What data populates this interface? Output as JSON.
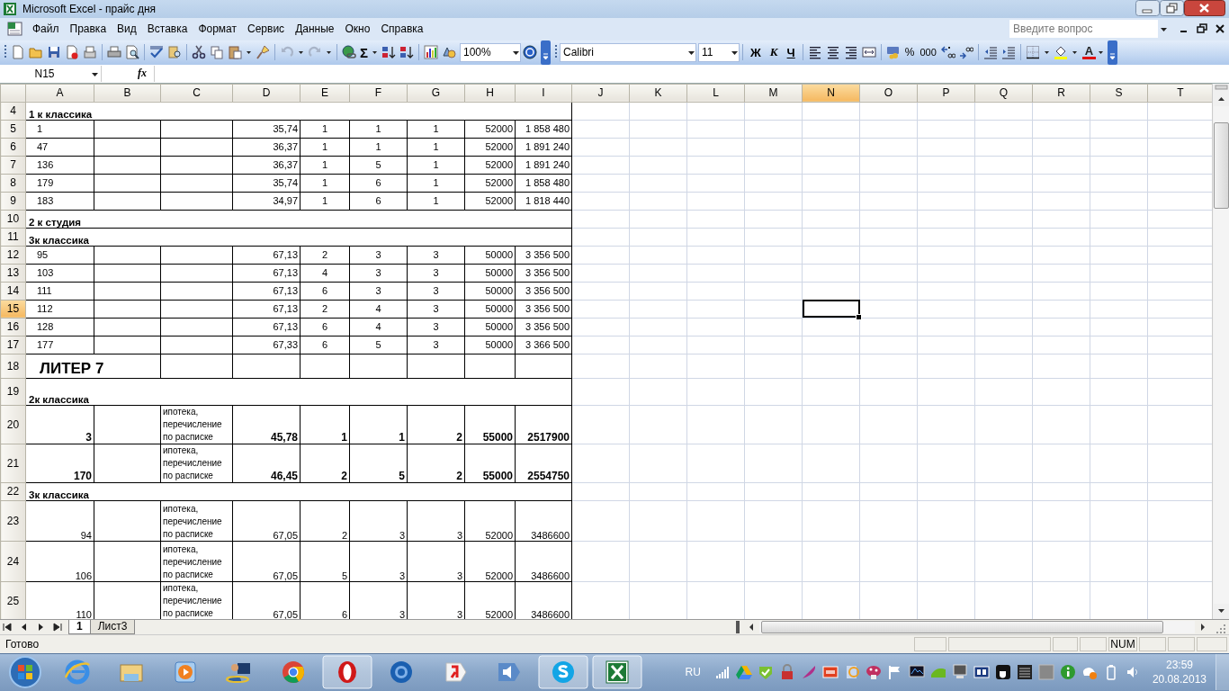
{
  "window": {
    "title": "Microsoft Excel - прайс дня"
  },
  "menu": [
    "Файл",
    "Правка",
    "Вид",
    "Вставка",
    "Формат",
    "Сервис",
    "Данные",
    "Окно",
    "Справка"
  ],
  "help_search": {
    "placeholder": "Введите вопрос"
  },
  "toolbar": {
    "undo": {
      "disabled": true
    },
    "redo": {
      "disabled": true
    },
    "sum": "Σ",
    "zoom": "100%",
    "font": "Calibri",
    "font_size": "11",
    "bold": "Ж",
    "italic": "К",
    "underline": "Ч",
    "percent": "%",
    "thousands": "000",
    "font_color": "A"
  },
  "formula_bar": {
    "name_box": "N15",
    "fx": "fx"
  },
  "sheet": {
    "columns": [
      {
        "letter": "A",
        "selected": false
      },
      {
        "letter": "B",
        "selected": false
      },
      {
        "letter": "C",
        "selected": false
      },
      {
        "letter": "D",
        "selected": false
      },
      {
        "letter": "E",
        "selected": false
      },
      {
        "letter": "F",
        "selected": false
      },
      {
        "letter": "G",
        "selected": false
      },
      {
        "letter": "H",
        "selected": false
      },
      {
        "letter": "I",
        "selected": false
      },
      {
        "letter": "J",
        "selected": false
      },
      {
        "letter": "K",
        "selected": false
      },
      {
        "letter": "L",
        "selected": false
      },
      {
        "letter": "M",
        "selected": false
      },
      {
        "letter": "N",
        "selected": true
      },
      {
        "letter": "O",
        "selected": false
      },
      {
        "letter": "P",
        "selected": false
      },
      {
        "letter": "Q",
        "selected": false
      },
      {
        "letter": "R",
        "selected": false
      },
      {
        "letter": "S",
        "selected": false
      },
      {
        "letter": "T",
        "selected": false
      }
    ],
    "rows": [
      {
        "number": "4",
        "selected": false,
        "kind": "section",
        "label": "1 к классика"
      },
      {
        "number": "5",
        "selected": false,
        "kind": "unit",
        "cells": {
          "A": "1",
          "D": "35,74",
          "E": "1",
          "F": "1",
          "G": "1",
          "H": "52000",
          "I": "1 858 480"
        }
      },
      {
        "number": "6",
        "selected": false,
        "kind": "unit",
        "cells": {
          "A": "47",
          "D": "36,37",
          "E": "1",
          "F": "1",
          "G": "1",
          "H": "52000",
          "I": "1 891 240"
        }
      },
      {
        "number": "7",
        "selected": false,
        "kind": "unit",
        "cells": {
          "A": "136",
          "D": "36,37",
          "E": "1",
          "F": "5",
          "G": "1",
          "H": "52000",
          "I": "1 891 240"
        }
      },
      {
        "number": "8",
        "selected": false,
        "kind": "unit",
        "cells": {
          "A": "179",
          "D": "35,74",
          "E": "1",
          "F": "6",
          "G": "1",
          "H": "52000",
          "I": "1 858 480"
        }
      },
      {
        "number": "9",
        "selected": false,
        "kind": "unit",
        "cells": {
          "A": "183",
          "D": "34,97",
          "E": "1",
          "F": "6",
          "G": "1",
          "H": "52000",
          "I": "1 818 440"
        }
      },
      {
        "number": "10",
        "selected": false,
        "kind": "section",
        "label": "2 к студия"
      },
      {
        "number": "11",
        "selected": false,
        "kind": "section",
        "label": "3к классика"
      },
      {
        "number": "12",
        "selected": false,
        "kind": "unit",
        "cells": {
          "A": "95",
          "D": "67,13",
          "E": "2",
          "F": "3",
          "G": "3",
          "H": "50000",
          "I": "3 356 500"
        }
      },
      {
        "number": "13",
        "selected": false,
        "kind": "unit",
        "cells": {
          "A": "103",
          "D": "67,13",
          "E": "4",
          "F": "3",
          "G": "3",
          "H": "50000",
          "I": "3 356 500"
        }
      },
      {
        "number": "14",
        "selected": false,
        "kind": "unit",
        "cells": {
          "A": "111",
          "D": "67,13",
          "E": "6",
          "F": "3",
          "G": "3",
          "H": "50000",
          "I": "3 356 500"
        }
      },
      {
        "number": "15",
        "selected": true,
        "kind": "unit",
        "cells": {
          "A": "112",
          "D": "67,13",
          "E": "2",
          "F": "4",
          "G": "3",
          "H": "50000",
          "I": "3 356 500"
        }
      },
      {
        "number": "16",
        "selected": false,
        "kind": "unit",
        "cells": {
          "A": "128",
          "D": "67,13",
          "E": "6",
          "F": "4",
          "G": "3",
          "H": "50000",
          "I": "3 356 500"
        }
      },
      {
        "number": "17",
        "selected": false,
        "kind": "unit",
        "cells": {
          "A": "177",
          "D": "67,33",
          "E": "6",
          "F": "5",
          "G": "3",
          "H": "50000",
          "I": "3 366 500"
        }
      },
      {
        "number": "18",
        "selected": false,
        "kind": "title",
        "label": "ЛИТЕР 7"
      },
      {
        "number": "19",
        "selected": false,
        "kind": "section",
        "label": "2к классика"
      },
      {
        "number": "20",
        "selected": false,
        "kind": "detail",
        "bold": true,
        "cells": {
          "A": "3",
          "C": "ипотека, перечисление по расписке",
          "D": "45,78",
          "E": "1",
          "F": "1",
          "G": "2",
          "H": "55000",
          "I": "2517900"
        }
      },
      {
        "number": "21",
        "selected": false,
        "kind": "detail",
        "bold": true,
        "cells": {
          "A": "170",
          "C": "ипотека, перечисление по расписке",
          "D": "46,45",
          "E": "2",
          "F": "5",
          "G": "2",
          "H": "55000",
          "I": "2554750"
        }
      },
      {
        "number": "22",
        "selected": false,
        "kind": "section",
        "label": "3к классика"
      },
      {
        "number": "23",
        "selected": false,
        "kind": "detail",
        "bold": false,
        "cells": {
          "A": "94",
          "C": "ипотека, перечисление по расписке",
          "D": "67,05",
          "E": "2",
          "F": "3",
          "G": "3",
          "H": "52000",
          "I": "3486600"
        }
      },
      {
        "number": "24",
        "selected": false,
        "kind": "detail",
        "bold": false,
        "cells": {
          "A": "106",
          "C": "ипотека, перечисление по расписке",
          "D": "67,05",
          "E": "5",
          "F": "3",
          "G": "3",
          "H": "52000",
          "I": "3486600"
        }
      },
      {
        "number": "25",
        "selected": false,
        "kind": "detail",
        "bold": false,
        "cells": {
          "A": "110",
          "C": "ипотека, перечисление по расписке",
          "D": "67,05",
          "E": "6",
          "F": "3",
          "G": "3",
          "H": "52000",
          "I": "3486600"
        }
      }
    ]
  },
  "sheet_tabs": [
    {
      "label": "1",
      "selected": true
    },
    {
      "label": "Лист3",
      "selected": false
    }
  ],
  "status_bar": {
    "status": "Готово",
    "indicator": "NUM"
  },
  "taskbar": {
    "apps": [
      {
        "running": false
      },
      {
        "running": false
      },
      {
        "running": false
      },
      {
        "running": false
      },
      {
        "running": false
      },
      {
        "running": true
      },
      {
        "running": false
      },
      {
        "running": false
      },
      {
        "running": false
      },
      {
        "running": true
      },
      {
        "running": true
      }
    ],
    "language": "RU",
    "time": "23:59",
    "date": "20.08.2013"
  }
}
